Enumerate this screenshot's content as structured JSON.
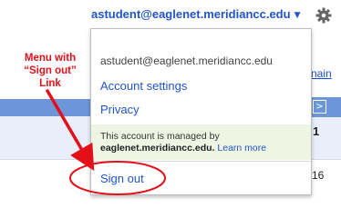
{
  "header": {
    "user_email": "astudent@eaglenet.meridiancc.edu"
  },
  "dropdown": {
    "email": "astudent@eaglenet.meridiancc.edu",
    "account_settings": "Account settings",
    "privacy": "Privacy",
    "managed_prefix": "This account is managed by",
    "managed_domain": "eaglenet.meridiancc.edu.",
    "learn_more": "Learn more",
    "sign_out": "Sign out"
  },
  "background": {
    "right_link": "nain",
    "nav_arrow": ">",
    "row_count": "1",
    "row_value": "16"
  },
  "annotation": {
    "line1": "Menu with",
    "line2": "“Sign out”",
    "line3": "Link"
  },
  "colors": {
    "link": "#2255cc",
    "annotation": "#e3101a",
    "managed_bg": "#eef5e3",
    "header_band": "#6d96d9"
  },
  "icons": {
    "settings": "gear-icon",
    "user_menu_caret": "chevron-down-icon"
  }
}
